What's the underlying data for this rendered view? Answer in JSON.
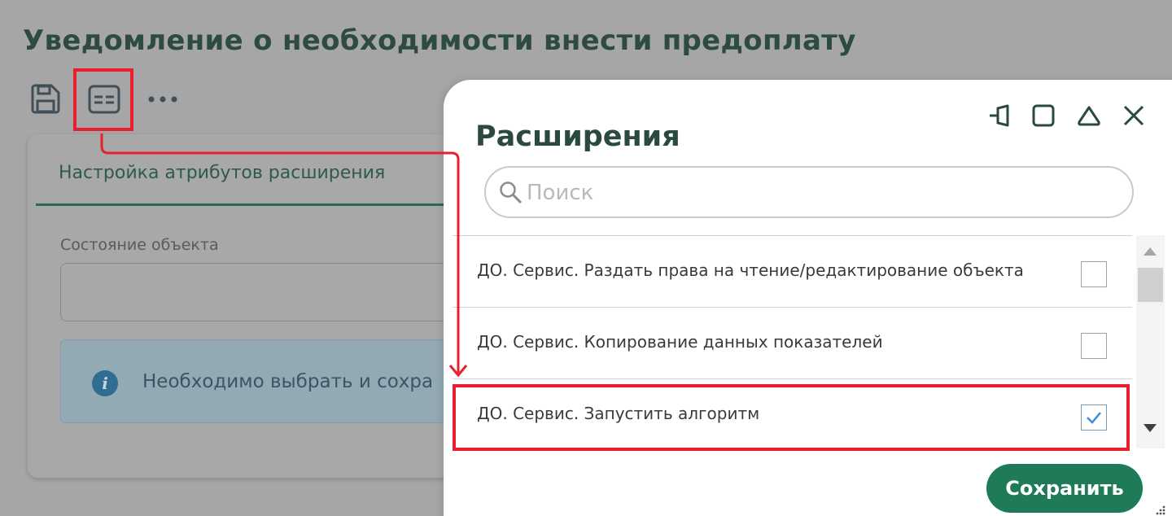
{
  "page": {
    "title": "Уведомление о необходимости внести предоплату",
    "toolbar": {
      "save_icon": "floppy-disk-icon",
      "extensions_icon": "extensions-card-icon",
      "more_icon": "more-horizontal-icon"
    },
    "tab_label": "Настройка атрибутов расширения",
    "field_label": "Состояние объекта",
    "field_value": "",
    "info_text": "Необходимо выбрать и сохра",
    "info_icon_glyph": "i"
  },
  "modal": {
    "title": "Расширения",
    "controls": [
      "pin-icon",
      "maximize-icon",
      "collapse-icon",
      "close-icon"
    ],
    "search": {
      "placeholder": "Поиск",
      "value": ""
    },
    "items": [
      {
        "label": "ДО. Сервис. Раздать права на чтение/редактирование объекта",
        "checked": false
      },
      {
        "label": "ДО. Сервис. Копирование данных показателей",
        "checked": false
      },
      {
        "label": "ДО. Сервис. Запустить алгоритм",
        "checked": true
      }
    ],
    "save_label": "Сохранить"
  },
  "colors": {
    "accent_green": "#1f7a58",
    "title_green": "#2b4a3f",
    "highlight_red": "#e8202e",
    "check_blue": "#3d8fd1"
  }
}
